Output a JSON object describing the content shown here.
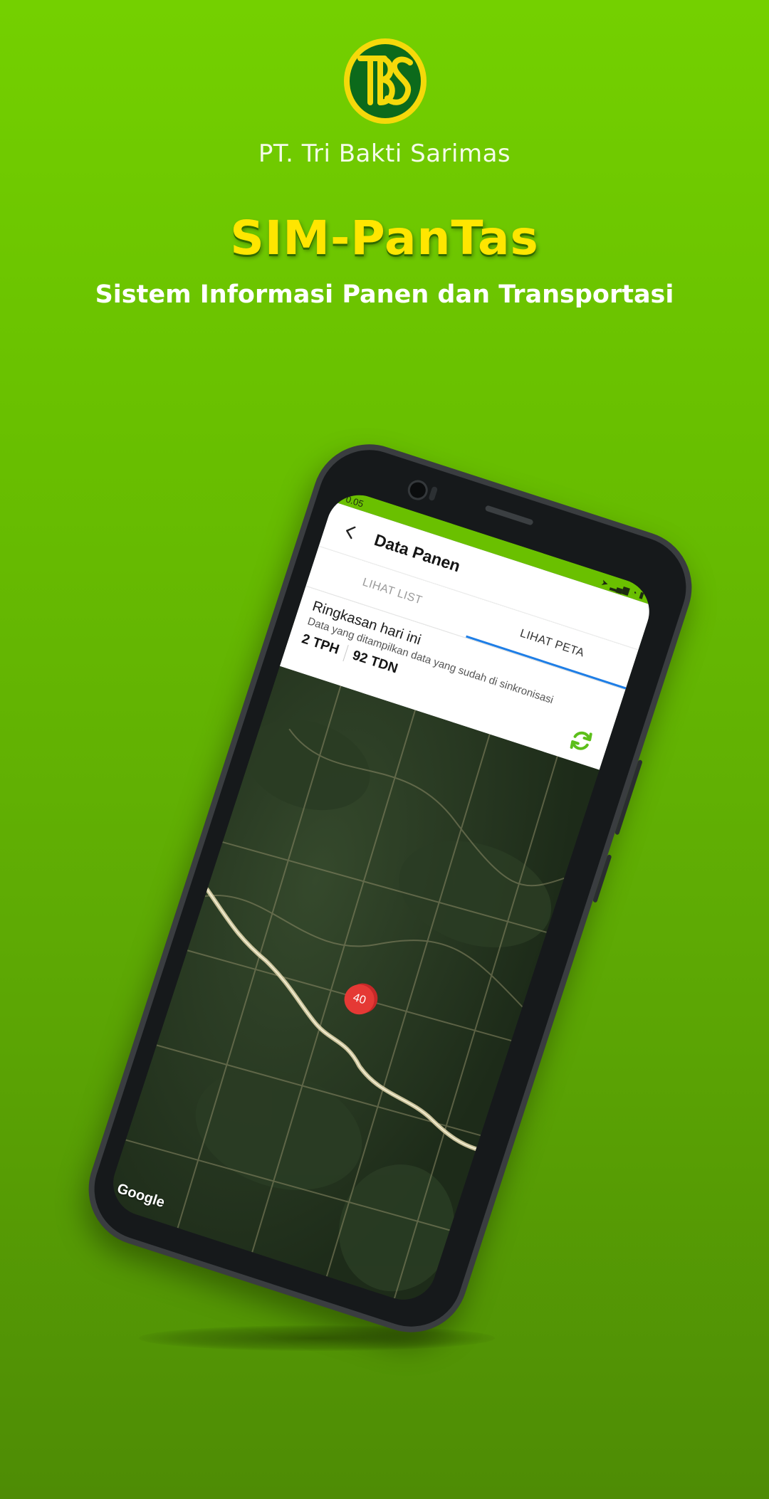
{
  "brand": {
    "company": "PT. Tri Bakti Sarimas",
    "app_title": "SIM-PanTas",
    "app_subtitle": "Sistem Informasi Panen dan Transportasi",
    "logo_text": "TBS",
    "colors": {
      "background": "#6cc400",
      "title_yellow": "#ffe600",
      "logo_green": "#0c6a1b",
      "logo_yellow": "#f5d90a"
    }
  },
  "phone": {
    "status_bar": {
      "time": "0.05",
      "icons": [
        "location-icon",
        "signal-icon",
        "wifi-icon",
        "battery-icon"
      ]
    },
    "app_bar": {
      "title": "Data Panen",
      "back_icon": "arrow-left-icon"
    },
    "tabs": [
      {
        "label": "LIHAT LIST",
        "active": false
      },
      {
        "label": "LIHAT PETA",
        "active": true
      }
    ],
    "summary": {
      "title": "Ringkasan hari ini",
      "note": "Data yang ditampilkan data yang sudah di sinkronisasi",
      "tph": "2 TPH",
      "tdn": "92 TDN",
      "refresh_icon": "sync-icon"
    },
    "map": {
      "marker_count": "40",
      "attribution": "Google"
    }
  }
}
